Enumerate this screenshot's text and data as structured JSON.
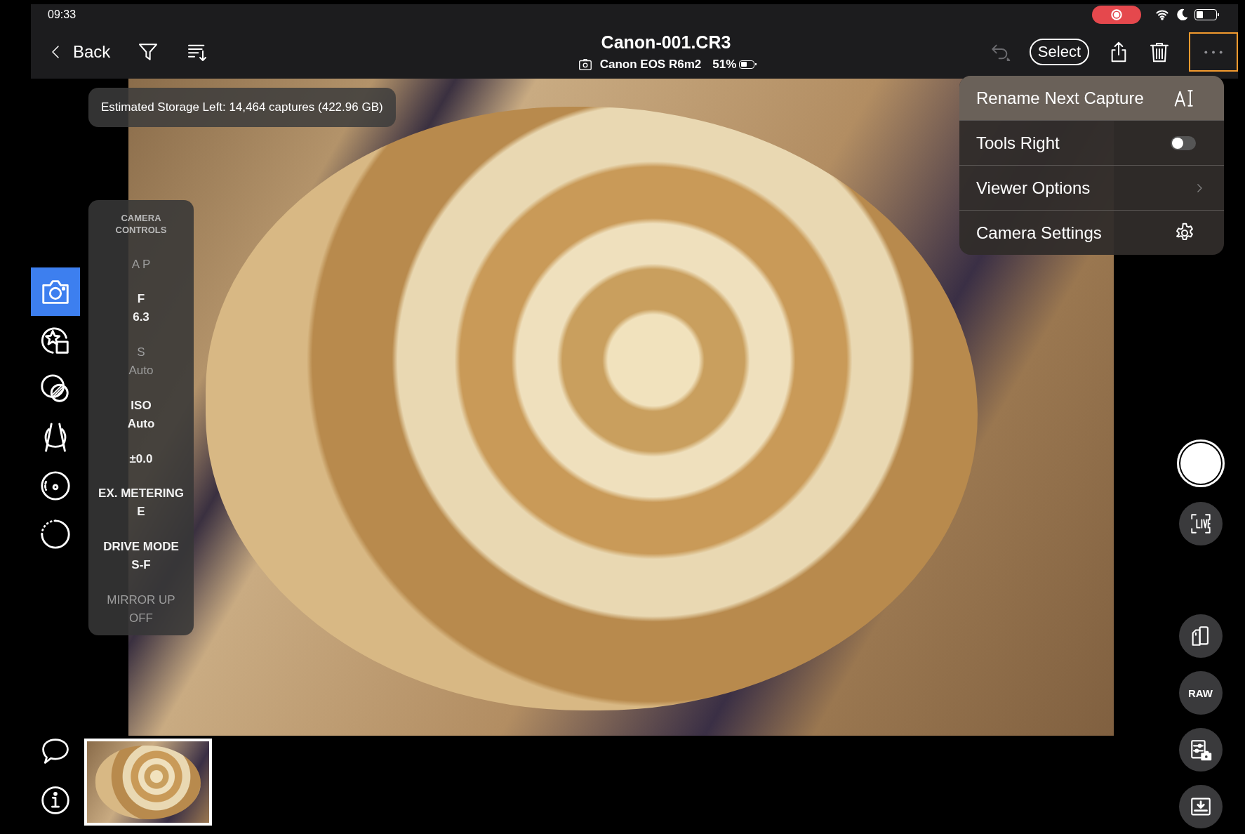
{
  "status_bar": {
    "time": "09:33",
    "recording": true
  },
  "toolbar": {
    "back": "Back",
    "title": "Canon-001.CR3",
    "camera": "Canon EOS R6m2",
    "battery": "51%",
    "undo_disabled": true,
    "select": "Select",
    "more_highlighted": true
  },
  "storage": "Estimated Storage Left: 14,464 captures (422.96 GB)",
  "tools": [
    {
      "kind": "camera",
      "selected": true
    },
    {
      "kind": "star",
      "selected": false
    },
    {
      "kind": "overlay",
      "selected": false
    },
    {
      "kind": "perspective",
      "selected": false
    },
    {
      "kind": "focus",
      "selected": false
    },
    {
      "kind": "dotted",
      "selected": false
    }
  ],
  "bottom_tools": [
    {
      "kind": "comment"
    },
    {
      "kind": "info"
    }
  ],
  "camera_controls": {
    "title": "CAMERA CONTROLS",
    "items": [
      {
        "label": "A P",
        "disabled": true
      },
      {
        "label": "F",
        "value": "6.3",
        "disabled": false
      },
      {
        "label": "S",
        "value": "Auto",
        "disabled": true
      },
      {
        "label": "ISO",
        "value": "Auto",
        "disabled": false
      },
      {
        "label": "±0.0",
        "disabled": false
      },
      {
        "label": "EX. METERING",
        "value": "E",
        "disabled": false
      },
      {
        "label": "DRIVE MODE",
        "value": "S-F",
        "disabled": false
      },
      {
        "label": "MIRROR UP",
        "value": "OFF",
        "disabled": true
      }
    ]
  },
  "menu": [
    {
      "label": "Rename Next Capture",
      "kind": "rename",
      "selected": true
    },
    {
      "label": "Tools Right",
      "kind": "toggle",
      "on": false,
      "selected": false
    },
    {
      "label": "Viewer Options",
      "kind": "submenu",
      "selected": false
    },
    {
      "label": "Camera Settings",
      "kind": "settings",
      "selected": false
    }
  ],
  "right_tools": [
    {
      "kind": "shutter"
    },
    {
      "kind": "live"
    },
    {
      "kind": "card-phone"
    },
    {
      "kind": "raw",
      "label": "RAW"
    },
    {
      "kind": "settings-camera"
    },
    {
      "kind": "import"
    }
  ],
  "filmstrip": [
    {
      "selected": true
    }
  ]
}
